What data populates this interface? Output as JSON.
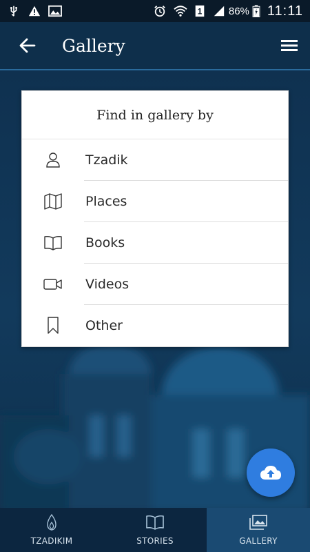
{
  "status_bar": {
    "battery": "86%",
    "time": "11:11",
    "sim": "1",
    "icons_left": [
      "usb-icon",
      "warning-icon",
      "image-icon"
    ],
    "icons_right": [
      "alarm-icon",
      "wifi-icon",
      "sim-icon",
      "signal-icon",
      "battery-icon"
    ]
  },
  "app_bar": {
    "title": "Gallery",
    "back_icon": "arrow-left-icon",
    "menu_icon": "hamburger-menu-icon"
  },
  "dialog": {
    "title": "Find in gallery by",
    "options": [
      {
        "label": "Tzadik",
        "icon": "person-icon"
      },
      {
        "label": "Places",
        "icon": "map-icon"
      },
      {
        "label": "Books",
        "icon": "book-icon"
      },
      {
        "label": "Videos",
        "icon": "video-camera-icon"
      },
      {
        "label": "Other",
        "icon": "bookmark-icon"
      }
    ]
  },
  "fab": {
    "icon": "cloud-upload-icon"
  },
  "bottom_nav": {
    "items": [
      {
        "label": "TZADIKIM",
        "icon": "flame-icon",
        "active": false
      },
      {
        "label": "STORIES",
        "icon": "open-book-icon",
        "active": false
      },
      {
        "label": "GALLERY",
        "icon": "images-icon",
        "active": true
      }
    ]
  },
  "colors": {
    "app_bar": "#0e2f4b",
    "app_bar_underline": "#2a6b9c",
    "fab": "#2f7de0",
    "bottom_nav": "#0c2640",
    "bottom_nav_active": "#1a4a72"
  }
}
